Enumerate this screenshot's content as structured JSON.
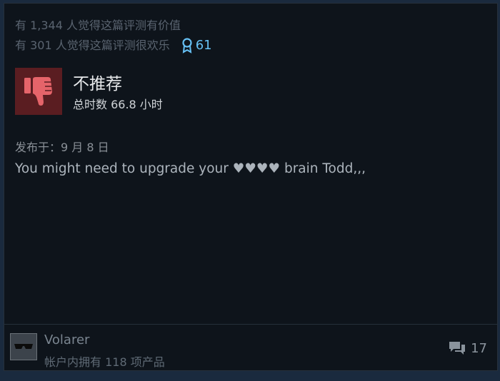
{
  "stats": {
    "helpful_text": "有 1,344 人觉得这篇评测有价值",
    "funny_text": "有 301 人觉得这篇评测很欢乐",
    "award_count": "61"
  },
  "review": {
    "verdict": "不推荐",
    "hours": "总时数 66.8 小时",
    "posted": "发布于：9 月 8 日",
    "text": "You might need to upgrade your ♥♥♥♥ brain Todd,,,"
  },
  "author": {
    "name": "Volarer",
    "products": "帐户内拥有 118 项产品"
  },
  "comments": {
    "count": "17"
  },
  "colors": {
    "background": "#1a2a3e",
    "card": "#0e141b",
    "thumb_bg": "#5a1d21",
    "thumb_icon": "#e5646a",
    "accent": "#66c0f4"
  },
  "icons": [
    "award-icon",
    "thumbs-down-icon",
    "comment-icon"
  ]
}
